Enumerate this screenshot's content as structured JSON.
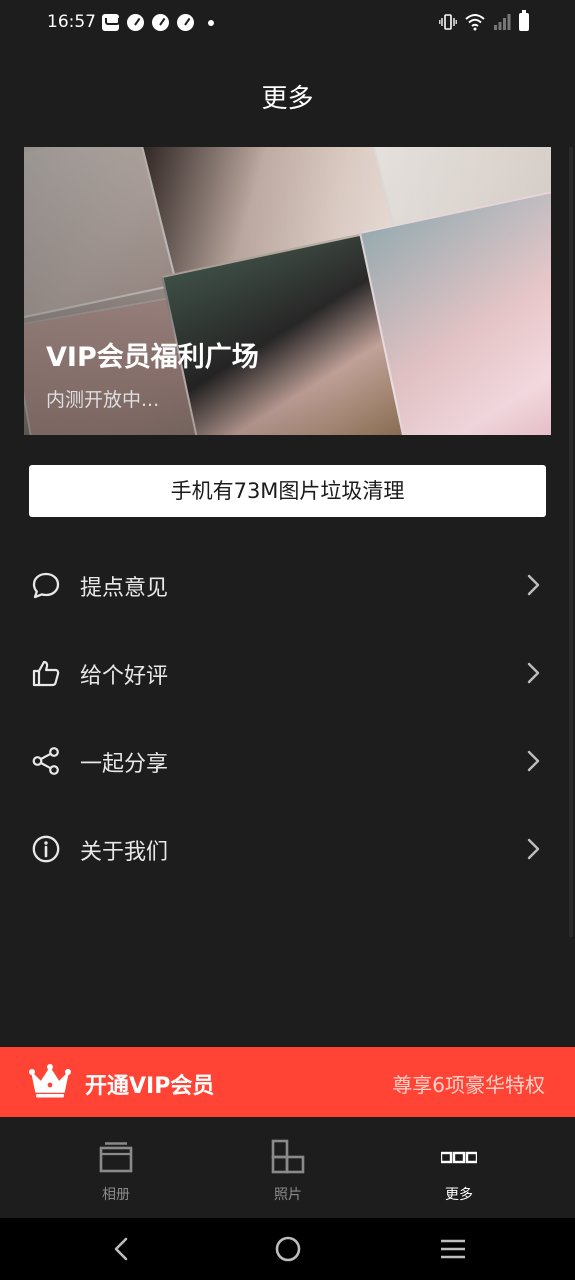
{
  "status_bar": {
    "time": "16:57",
    "left_icons": [
      "mail-icon",
      "speedometer-icon",
      "speedometer-icon",
      "speedometer-icon",
      "dot-icon"
    ],
    "right_icons": [
      "vibrate-icon",
      "wifi-icon",
      "signal-icon",
      "battery-icon"
    ]
  },
  "page": {
    "title": "更多"
  },
  "banner": {
    "title": "VIP会员福利广场",
    "subtitle": "内测开放中..."
  },
  "clean_button": {
    "label": "手机有73M图片垃圾清理"
  },
  "menu": {
    "items": [
      {
        "label": "提点意见",
        "icon": "chat-bubble-icon"
      },
      {
        "label": "给个好评",
        "icon": "thumbs-up-icon"
      },
      {
        "label": "一起分享",
        "icon": "share-icon"
      },
      {
        "label": "关于我们",
        "icon": "info-icon"
      }
    ]
  },
  "vip_bar": {
    "label": "开通VIP会员",
    "subtitle": "尊享6项豪华特权",
    "color": "#ff4436"
  },
  "bottom_nav": {
    "items": [
      {
        "label": "相册",
        "icon": "album-icon",
        "active": false
      },
      {
        "label": "照片",
        "icon": "photos-grid-icon",
        "active": false
      },
      {
        "label": "更多",
        "icon": "more-dots-icon",
        "active": true
      }
    ]
  },
  "system_nav": {
    "buttons": [
      "back-icon",
      "home-icon",
      "recents-icon"
    ]
  }
}
